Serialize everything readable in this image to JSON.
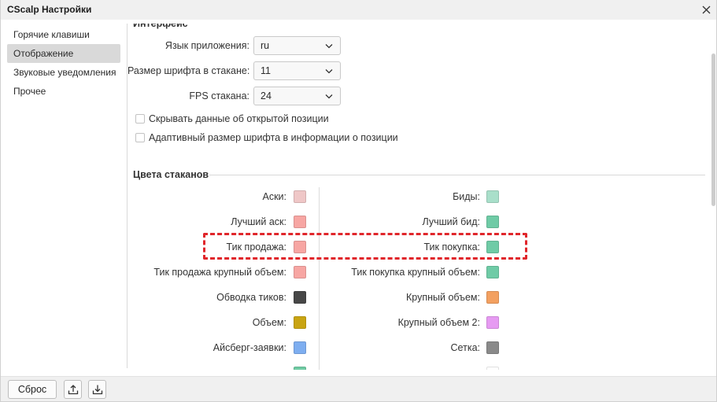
{
  "window": {
    "title": "CScalp Настройки",
    "close_icon": "close-icon"
  },
  "sidebar": {
    "items": [
      {
        "label": "Горячие клавиши",
        "selected": false
      },
      {
        "label": "Отображение",
        "selected": true
      },
      {
        "label": "Звуковые уведомления",
        "selected": false
      },
      {
        "label": "Прочее",
        "selected": false
      }
    ]
  },
  "interface": {
    "heading": "Интерфейс",
    "fields": [
      {
        "label": "Язык приложения:",
        "value": "ru"
      },
      {
        "label": "Размер шрифта в стакане:",
        "value": "11"
      },
      {
        "label": "FPS стакана:",
        "value": "24"
      }
    ],
    "checkboxes": [
      {
        "label": "Скрывать данные об открытой позиции",
        "checked": false
      },
      {
        "label": "Адаптивный размер шрифта в информации о позиции",
        "checked": false
      }
    ]
  },
  "dom_colors": {
    "heading": "Цвета стаканов",
    "left": [
      {
        "label": "Аски:",
        "color": "#efc7c7"
      },
      {
        "label": "Лучший аск:",
        "color": "#f7a6a3"
      },
      {
        "label": "Тик продажа:",
        "color": "#f7a6a3"
      },
      {
        "label": "Тик продажа крупный объем:",
        "color": "#f7a6a3"
      },
      {
        "label": "Обводка тиков:",
        "color": "#474747"
      },
      {
        "label": "Объем:",
        "color": "#c9a412"
      },
      {
        "label": "Айсберг-заявки:",
        "color": "#7eaef0"
      },
      {
        "color": "#6fcba3"
      }
    ],
    "right": [
      {
        "label": "Биды:",
        "color": "#a9dfca"
      },
      {
        "label": "Лучший бид:",
        "color": "#6fcba6"
      },
      {
        "label": "Тик покупка:",
        "color": "#6fcba6"
      },
      {
        "label": "Тик покупка крупный объем:",
        "color": "#6fcba6"
      },
      {
        "label": "Крупный объем:",
        "color": "#f3a060"
      },
      {
        "label": "Крупный объем 2:",
        "color": "#e69af2"
      },
      {
        "label": "Сетка:",
        "color": "#8a8a8a"
      },
      {
        "color": "#ffffff"
      }
    ]
  },
  "footer": {
    "reset_label": "Сброс",
    "upload_icon": "upload-icon",
    "download_icon": "download-icon"
  }
}
